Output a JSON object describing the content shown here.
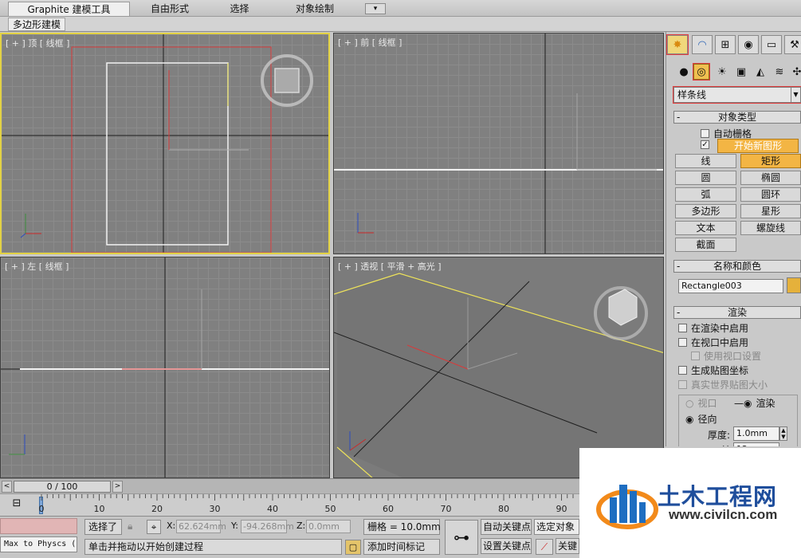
{
  "ribbon": {
    "tabs": [
      "Graphite 建模工具",
      "自由形式",
      "选择",
      "对象绘制"
    ],
    "active_tab": 0,
    "dropdown_glyph": "▾",
    "sub_tab": "多边形建模"
  },
  "viewports": {
    "top": "[ + ] 顶 [ 线框 ]",
    "front": "[ + ] 前 [ 线框 ]",
    "left": "[ + ] 左 [ 线框 ]",
    "perspective": "[ + ] 透视 [ 平滑 + 高光 ]",
    "axis_x": "x",
    "axis_y": "y",
    "axis_z": "z"
  },
  "command_panel": {
    "tab_icons": [
      "create-icon",
      "modify-icon",
      "hierarchy-icon",
      "motion-icon",
      "display-icon",
      "utilities-icon"
    ],
    "sub_icons": [
      "geometry-icon",
      "shapes-icon",
      "lights-icon",
      "cameras-icon",
      "helpers-icon",
      "spacewarps-icon",
      "systems-icon"
    ],
    "category": "样条线",
    "object_type": {
      "title": "对象类型",
      "auto_grid": "自动栅格",
      "start_new_shape": "开始新图形",
      "buttons": [
        "线",
        "矩形",
        "圆",
        "椭圆",
        "弧",
        "圆环",
        "多边形",
        "星形",
        "文本",
        "螺旋线",
        "截面"
      ],
      "active_button": "矩形"
    },
    "name_color": {
      "title": "名称和颜色",
      "name": "Rectangle003",
      "swatch": "#e5b13b"
    },
    "render": {
      "title": "渲染",
      "enable_render": "在渲染中启用",
      "enable_viewport": "在视口中启用",
      "use_viewport_settings": "使用视口设置",
      "gen_mapping": "生成贴图坐标",
      "real_world": "真实世界贴图大小",
      "viewport_radio": "视口",
      "render_radio": "渲染",
      "radial": "径向",
      "thickness_label": "厚度:",
      "thickness_value": "1.0mm",
      "sides_label": "边",
      "sides_value": "12"
    }
  },
  "timeslider": {
    "frame": "0 / 100",
    "prev": "<",
    "next": ">",
    "ticks": [
      "0",
      "10",
      "20",
      "30",
      "40",
      "50",
      "60",
      "70",
      "80",
      "90"
    ]
  },
  "status": {
    "script_label": "Max to Physcs (",
    "selection": "选择了",
    "x_label": "X:",
    "x_value": "62.624mm",
    "y_label": "Y:",
    "y_value": "-94.268mm",
    "z_label": "Z:",
    "z_value": "0.0mm",
    "grid": "栅格 = 10.0mm",
    "prompt": "单击并拖动以开始创建过程",
    "add_time_tag": "添加时间标记",
    "auto_key": "自动关键点",
    "set_key": "设置关键点",
    "selected_object": "选定对象",
    "key_filters": "关键"
  },
  "watermark": {
    "title": "土木工程网",
    "url": "www.civilcn.com"
  }
}
